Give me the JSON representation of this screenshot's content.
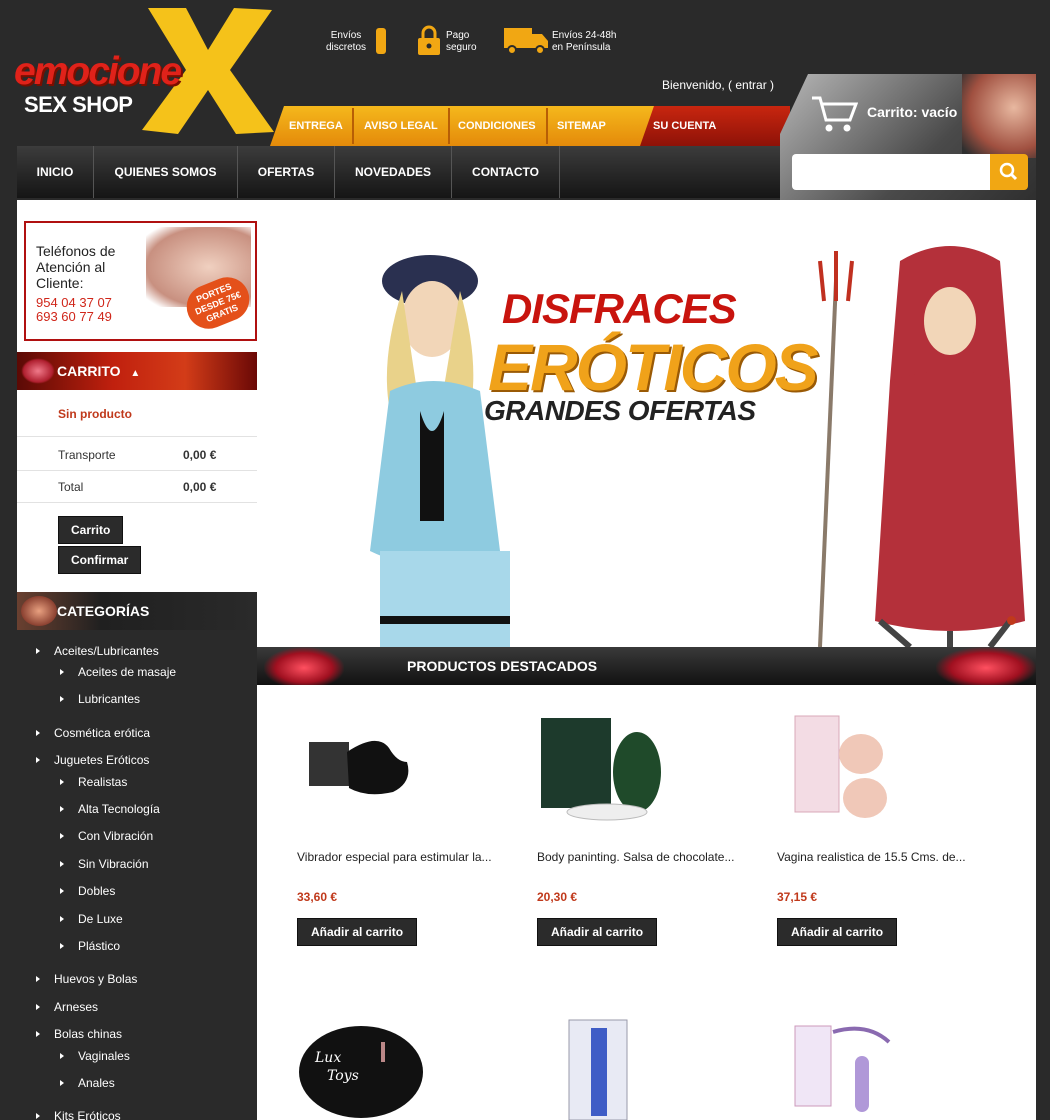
{
  "logo": {
    "line1": "emocione",
    "line2": "SEX SHOP"
  },
  "features": [
    {
      "line1": "Envíos",
      "line2": "discretos"
    },
    {
      "line1": "Pago",
      "line2": "seguro"
    },
    {
      "line1": "Envíos 24-48h",
      "line2": "en Península"
    }
  ],
  "welcome": "Bienvenido, ( entrar )",
  "topmenu": [
    "ENTREGA",
    "AVISO LEGAL",
    "CONDICIONES",
    "SITEMAP",
    "SU CUENTA"
  ],
  "cart_header": "Carrito: vacío",
  "search": {
    "placeholder": ""
  },
  "nav": [
    "INICIO",
    "QUIENES SOMOS",
    "OFERTAS",
    "NOVEDADES",
    "CONTACTO"
  ],
  "phone_box": {
    "line1": "Teléfonos de",
    "line2": "Atención al",
    "line3": "Cliente:",
    "phone1": "954 04 37 07",
    "phone2": "693 60 77 49",
    "stamp1": "PORTES",
    "stamp2": "DESDE 75€",
    "stamp3": "GRATIS"
  },
  "cart_block": {
    "title": "CARRITO",
    "empty": "Sin producto",
    "shipping_label": "Transporte",
    "shipping_value": "0,00 €",
    "total_label": "Total",
    "total_value": "0,00 €",
    "btn_cart": "Carrito",
    "btn_confirm": "Confirmar"
  },
  "categories": {
    "title": "CATEGORÍAS",
    "items": [
      {
        "label": "Aceites/Lubricantes",
        "level": 0
      },
      {
        "label": "Aceites de masaje",
        "level": 1
      },
      {
        "label": "Lubricantes",
        "level": 1
      },
      {
        "label": "Cosmética erótica",
        "level": 0
      },
      {
        "label": "Juguetes Eróticos",
        "level": 0
      },
      {
        "label": "Realistas",
        "level": 1
      },
      {
        "label": "Alta Tecnología",
        "level": 1
      },
      {
        "label": "Con Vibración",
        "level": 1
      },
      {
        "label": "Sin Vibración",
        "level": 1
      },
      {
        "label": "Dobles",
        "level": 1
      },
      {
        "label": "De Luxe",
        "level": 1
      },
      {
        "label": "Plástico",
        "level": 1
      },
      {
        "label": "Huevos y Bolas",
        "level": 0
      },
      {
        "label": "Arneses",
        "level": 0
      },
      {
        "label": "Bolas chinas",
        "level": 0
      },
      {
        "label": "Vaginales",
        "level": 1
      },
      {
        "label": "Anales",
        "level": 1
      },
      {
        "label": "Kits Eróticos",
        "level": 0
      }
    ]
  },
  "banner": {
    "line1": "DISFRACES",
    "line2": "ERÓTICOS",
    "line3": "GRANDES OFERTAS"
  },
  "featured": {
    "title": "PRODUCTOS DESTACADOS",
    "add_label": "Añadir al carrito",
    "products": [
      {
        "name": "Vibrador especial para estimular la...",
        "price": "33,60 €"
      },
      {
        "name": "Body paninting. Salsa de chocolate...",
        "price": "20,30 €"
      },
      {
        "name": "Vagina realistica de 15.5 Cms. de...",
        "price": "37,15 €"
      }
    ],
    "row2_texts": [
      "Lux",
      "Toys"
    ]
  },
  "colors": {
    "accent_orange": "#f1a713",
    "accent_red": "#c8260f",
    "price": "#c0391b",
    "dark": "#2a2a2a"
  }
}
